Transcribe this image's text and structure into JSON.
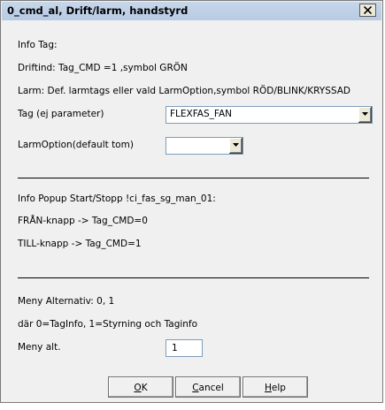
{
  "window": {
    "title": "0_cmd_al, Drift/larm, handstyrd"
  },
  "info": {
    "tag_header": "Info Tag:",
    "driftind": "Driftind: Tag_CMD =1 ,symbol GRÖN",
    "larm": "Larm: Def. larmtags eller vald LarmOption,symbol RÖD/BLINK/KRYSSAD"
  },
  "tag_field": {
    "label": "Tag (ej parameter)",
    "value": "FLEXFAS_FAN"
  },
  "larm_option_field": {
    "label": "LarmOption(default tom)",
    "value": ""
  },
  "popup": {
    "header": "Info Popup Start/Stopp !ci_fas_sg_man_01:",
    "fran": "FRÅN-knapp -> Tag_CMD=0",
    "till": "TILL-knapp -> Tag_CMD=1"
  },
  "menu": {
    "alternatives": "Meny Alternativ: 0, 1",
    "description": "där 0=TagInfo, 1=Styrning och Taginfo",
    "label": "Meny alt.",
    "value": "1"
  },
  "buttons": {
    "ok": {
      "mnemonic": "O",
      "rest": "K"
    },
    "cancel": {
      "mnemonic": "C",
      "rest": "ancel"
    },
    "help": {
      "mnemonic": "H",
      "rest": "elp"
    }
  }
}
